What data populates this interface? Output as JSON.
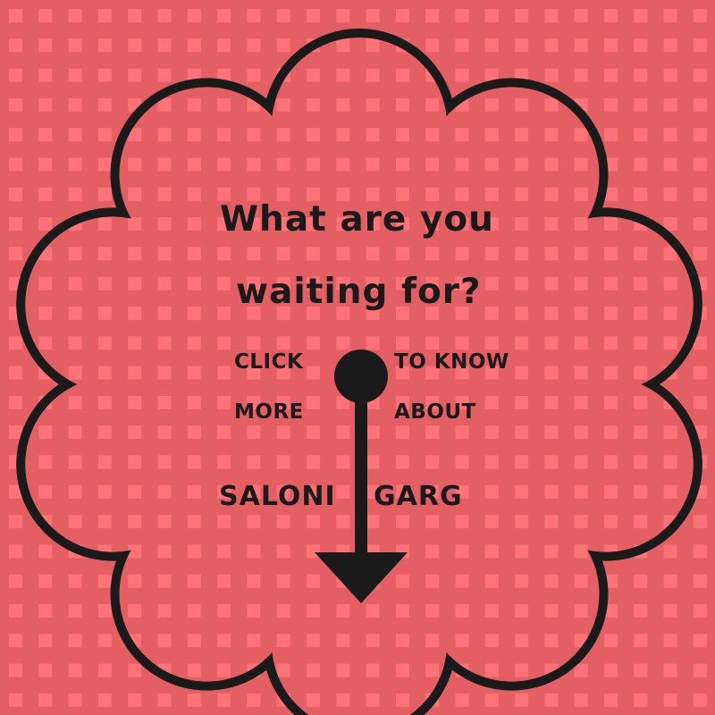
{
  "headline_line1": "What are you",
  "headline_line2": "waiting for?",
  "left_line1": "CLICK",
  "left_line2": "MORE",
  "right_line1": "TO KNOW",
  "right_line2": "ABOUT",
  "name_first": "SALONI",
  "name_last": "GARG",
  "colors": {
    "background": "#e35f63",
    "square": "#ff7277",
    "ink": "#1a1a1a"
  },
  "icons": [
    "scalloped-badge-outline",
    "pin-arrow-down-icon"
  ]
}
